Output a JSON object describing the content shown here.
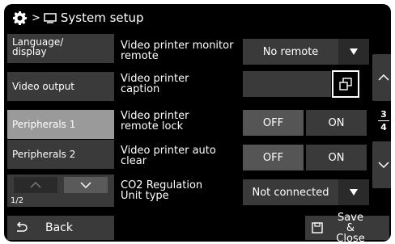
{
  "header": {
    "separator": ">",
    "title": "System setup",
    "settings_icon": "gear-icon",
    "display_icon": "monitor-icon"
  },
  "nav": {
    "items": [
      {
        "label": "Language/ display",
        "active": false
      },
      {
        "label": "Video output",
        "active": false
      },
      {
        "label": "Peripherals 1",
        "active": true
      },
      {
        "label": "Peripherals 2",
        "active": false
      }
    ],
    "pager": {
      "page": "1/2"
    }
  },
  "rows": [
    {
      "label": "Video printer monitor remote",
      "control": "dropdown",
      "value": "No remote"
    },
    {
      "label": "Video printer caption",
      "control": "button",
      "value": ""
    },
    {
      "label": "Video printer remote lock",
      "control": "toggle",
      "off_label": "OFF",
      "on_label": "ON"
    },
    {
      "label": "Video printer auto clear",
      "control": "toggle",
      "off_label": "OFF",
      "on_label": "ON"
    },
    {
      "label": "CO2 Regulation Unit type",
      "control": "dropdown",
      "value": "Not connected"
    }
  ],
  "scroll": {
    "current": "3",
    "total": "4"
  },
  "footer": {
    "back_label": "Back",
    "save_label": "Save & Close"
  },
  "colors": {
    "panel": "#000000",
    "button": "#3a3a3a",
    "active": "#9a9a9a",
    "text": "#ffffff"
  }
}
